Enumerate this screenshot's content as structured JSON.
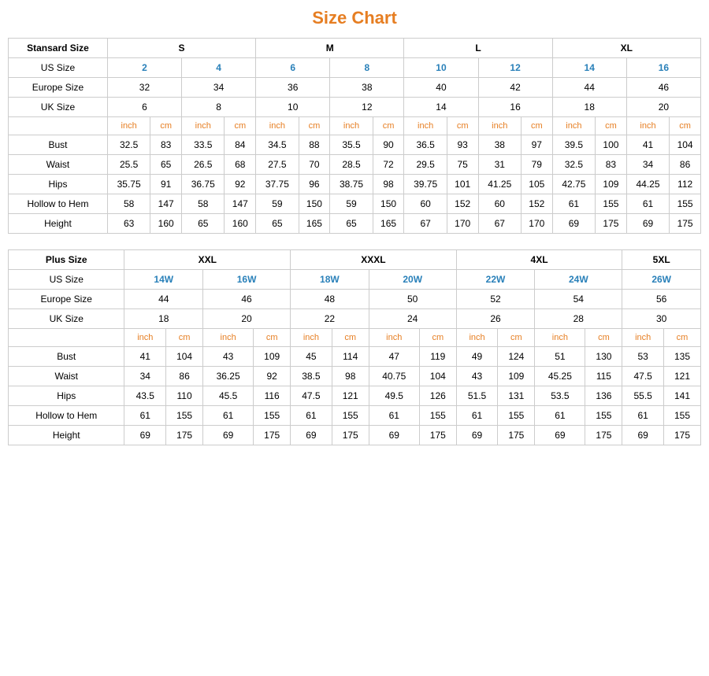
{
  "title": "Size Chart",
  "standard": {
    "headers": {
      "col1": "Stansard Size",
      "s": "S",
      "m": "M",
      "l": "L",
      "xl": "XL"
    },
    "rows": {
      "usSize": {
        "label": "US Size",
        "values": [
          "2",
          "4",
          "6",
          "8",
          "10",
          "12",
          "14",
          "16"
        ]
      },
      "europeSize": {
        "label": "Europe Size",
        "values": [
          "32",
          "34",
          "36",
          "38",
          "40",
          "42",
          "44",
          "46"
        ]
      },
      "ukSize": {
        "label": "UK Size",
        "values": [
          "6",
          "8",
          "10",
          "12",
          "14",
          "16",
          "18",
          "20"
        ]
      },
      "units": [
        "inch",
        "cm",
        "inch",
        "cm",
        "inch",
        "cm",
        "inch",
        "cm",
        "inch",
        "cm",
        "inch",
        "cm",
        "inch",
        "cm",
        "inch",
        "cm"
      ],
      "bust": {
        "label": "Bust",
        "values": [
          "32.5",
          "83",
          "33.5",
          "84",
          "34.5",
          "88",
          "35.5",
          "90",
          "36.5",
          "93",
          "38",
          "97",
          "39.5",
          "100",
          "41",
          "104"
        ]
      },
      "waist": {
        "label": "Waist",
        "values": [
          "25.5",
          "65",
          "26.5",
          "68",
          "27.5",
          "70",
          "28.5",
          "72",
          "29.5",
          "75",
          "31",
          "79",
          "32.5",
          "83",
          "34",
          "86"
        ]
      },
      "hips": {
        "label": "Hips",
        "values": [
          "35.75",
          "91",
          "36.75",
          "92",
          "37.75",
          "96",
          "38.75",
          "98",
          "39.75",
          "101",
          "41.25",
          "105",
          "42.75",
          "109",
          "44.25",
          "112"
        ]
      },
      "hollowToHem": {
        "label": "Hollow to Hem",
        "values": [
          "58",
          "147",
          "58",
          "147",
          "59",
          "150",
          "59",
          "150",
          "60",
          "152",
          "60",
          "152",
          "61",
          "155",
          "61",
          "155"
        ]
      },
      "height": {
        "label": "Height",
        "values": [
          "63",
          "160",
          "65",
          "160",
          "65",
          "165",
          "65",
          "165",
          "67",
          "170",
          "67",
          "170",
          "69",
          "175",
          "69",
          "175"
        ]
      }
    }
  },
  "plus": {
    "headers": {
      "col1": "Plus Size",
      "xxl": "XXL",
      "xxxl": "XXXL",
      "4xl": "4XL",
      "5xl": "5XL"
    },
    "rows": {
      "usSize": {
        "label": "US Size",
        "values": [
          "14W",
          "16W",
          "18W",
          "20W",
          "22W",
          "24W",
          "26W"
        ]
      },
      "europeSize": {
        "label": "Europe Size",
        "values": [
          "44",
          "46",
          "48",
          "50",
          "52",
          "54",
          "56"
        ]
      },
      "ukSize": {
        "label": "UK Size",
        "values": [
          "18",
          "20",
          "22",
          "24",
          "26",
          "28",
          "30"
        ]
      },
      "units": [
        "inch",
        "cm",
        "inch",
        "cm",
        "inch",
        "cm",
        "inch",
        "cm",
        "inch",
        "cm",
        "inch",
        "cm",
        "inch",
        "cm"
      ],
      "bust": {
        "label": "Bust",
        "values": [
          "41",
          "104",
          "43",
          "109",
          "45",
          "114",
          "47",
          "119",
          "49",
          "124",
          "51",
          "130",
          "53",
          "135"
        ]
      },
      "waist": {
        "label": "Waist",
        "values": [
          "34",
          "86",
          "36.25",
          "92",
          "38.5",
          "98",
          "40.75",
          "104",
          "43",
          "109",
          "45.25",
          "115",
          "47.5",
          "121"
        ]
      },
      "hips": {
        "label": "Hips",
        "values": [
          "43.5",
          "110",
          "45.5",
          "116",
          "47.5",
          "121",
          "49.5",
          "126",
          "51.5",
          "131",
          "53.5",
          "136",
          "55.5",
          "141"
        ]
      },
      "hollowToHem": {
        "label": "Hollow to Hem",
        "values": [
          "61",
          "155",
          "61",
          "155",
          "61",
          "155",
          "61",
          "155",
          "61",
          "155",
          "61",
          "155",
          "61",
          "155"
        ]
      },
      "height": {
        "label": "Height",
        "values": [
          "69",
          "175",
          "69",
          "175",
          "69",
          "175",
          "69",
          "175",
          "69",
          "175",
          "69",
          "175",
          "69",
          "175"
        ]
      }
    }
  }
}
